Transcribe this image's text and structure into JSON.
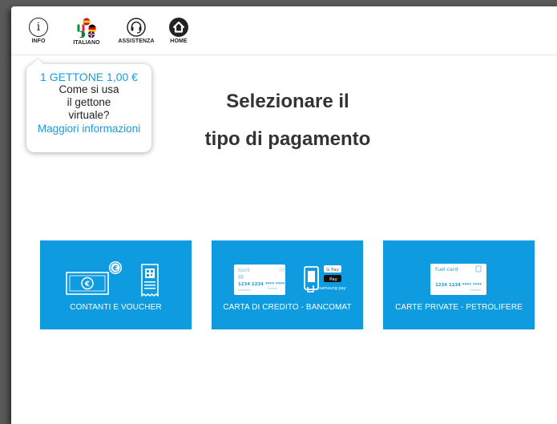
{
  "topbar": {
    "info_label": "INFO",
    "language_label": "ITALIANO",
    "support_label": "ASSISTENZA",
    "home_label": "HOME"
  },
  "tooltip": {
    "price": "1 GETTONE 1,00 €",
    "line1": "Come si usa",
    "line2": "il gettone",
    "line3": "virtuale?",
    "link": "Maggiori informazioni"
  },
  "heading": {
    "line1": "Selezionare il",
    "line2": "tipo di pagamento"
  },
  "payment_options": [
    {
      "label": "CONTANTI E VOUCHER",
      "icons": [
        "banknote-icon",
        "euro-coin-icon",
        "voucher-receipt-icon"
      ]
    },
    {
      "label": "CARTA DI CREDITO - BANCOMAT",
      "icons": [
        "bank-card-icon",
        "smartphone-pay-icon",
        "gpay-badge-icon",
        "apple-pay-badge-icon"
      ],
      "card_text": "Bank",
      "card_number": "1234 1234 **** ****",
      "badges": [
        "G Pay",
        "Pay",
        "samsung pay"
      ]
    },
    {
      "label": "CARTE PRIVATE - PETROLIFERE",
      "icons": [
        "fuel-card-icon"
      ],
      "card_text": "Fuel card",
      "card_number": "1234 1234 **** ****"
    }
  ],
  "colors": {
    "accent": "#0f9be0",
    "link": "#1c9be0",
    "text": "#333333"
  }
}
